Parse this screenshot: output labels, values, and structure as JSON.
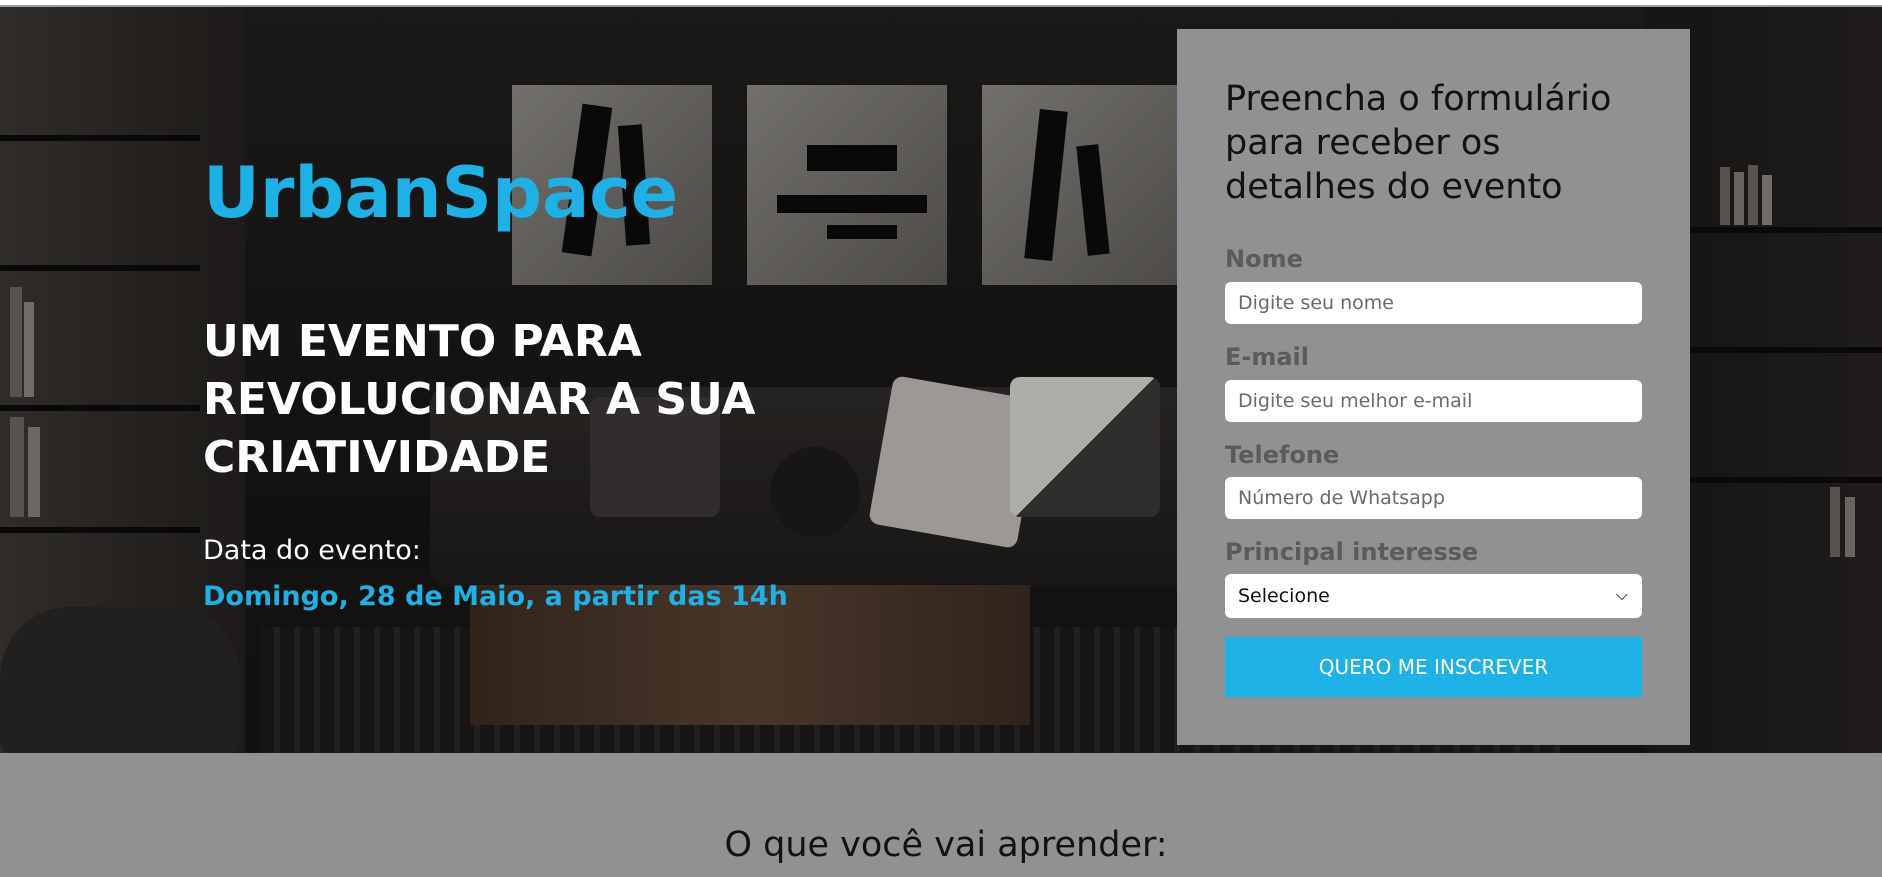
{
  "hero": {
    "brand": "UrbanSpace",
    "headline": "UM EVENTO PARA REVOLUCIONAR A SUA CRIATIVIDADE",
    "date_label": "Data do evento:",
    "date_value": "Domingo, 28 de Maio, a partir das 14h"
  },
  "form": {
    "title": "Preencha o formulário para receber os detalhes do evento",
    "fields": [
      {
        "label": "Nome",
        "placeholder": "Digite seu nome"
      },
      {
        "label": "E-mail",
        "placeholder": "Digite seu melhor e-mail"
      },
      {
        "label": "Telefone",
        "placeholder": "Número de Whatsapp"
      },
      {
        "label": "Principal interesse",
        "value": "Selecione"
      }
    ],
    "submit_label": "QUERO ME INSCREVER"
  },
  "section": {
    "title": "O que você vai aprender:"
  },
  "colors": {
    "accent": "#1eb1e6",
    "form_bg": "#909193"
  }
}
